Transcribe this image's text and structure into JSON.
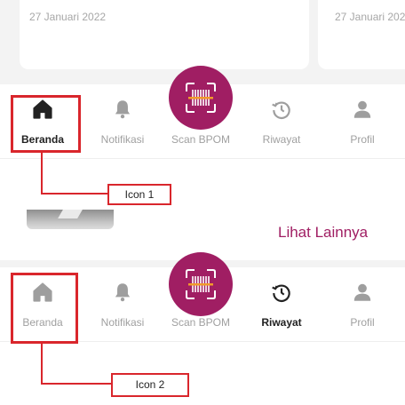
{
  "cards": [
    {
      "date": "27 Januari 2022"
    },
    {
      "date": "27 Januari 2022"
    }
  ],
  "nav_top": {
    "items": [
      {
        "label": "Beranda",
        "icon": "home-icon",
        "active": true
      },
      {
        "label": "Notifikasi",
        "icon": "bell-icon",
        "active": false
      },
      {
        "label": "Scan BPOM",
        "icon": "barcode-scan-icon",
        "active": false
      },
      {
        "label": "Riwayat",
        "icon": "history-icon",
        "active": false
      },
      {
        "label": "Profil",
        "icon": "profile-icon",
        "active": false
      }
    ]
  },
  "nav_bottom": {
    "items": [
      {
        "label": "Beranda",
        "icon": "home-icon",
        "active": false
      },
      {
        "label": "Notifikasi",
        "icon": "bell-icon",
        "active": false
      },
      {
        "label": "Scan BPOM",
        "icon": "barcode-scan-icon",
        "active": false
      },
      {
        "label": "Riwayat",
        "icon": "history-icon",
        "active": true
      },
      {
        "label": "Profil",
        "icon": "profile-icon",
        "active": false
      }
    ]
  },
  "see_more": "Lihat Lainnya",
  "annotations": {
    "icon1": "Icon 1",
    "icon2": "Icon 2"
  },
  "colors": {
    "brand": "#a01e63",
    "annotation": "#d9262c",
    "active_icon": "#222222",
    "inactive_icon": "#9e9e9e"
  }
}
